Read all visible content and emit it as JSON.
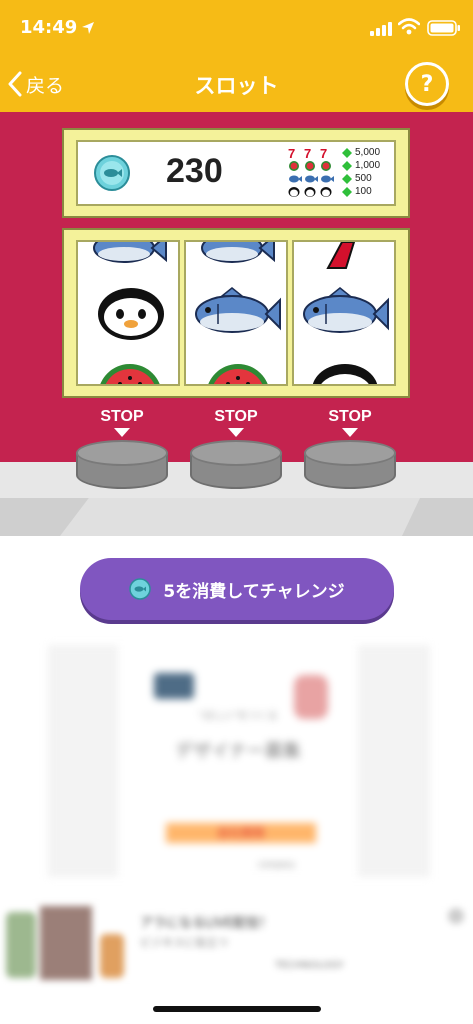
{
  "status_bar": {
    "time": "14:49"
  },
  "nav": {
    "back_label": "戻る",
    "title": "スロット",
    "help_label": "?"
  },
  "score": {
    "value": "230"
  },
  "paytable": [
    {
      "symbols": "777",
      "reward": "5,000"
    },
    {
      "symbols": "watermelon x3",
      "reward": "1,000"
    },
    {
      "symbols": "fish x3",
      "reward": "500"
    },
    {
      "symbols": "penguin x3",
      "reward": "100"
    }
  ],
  "reels": [
    {
      "top": "fish",
      "middle": "penguin",
      "bottom": "watermelon"
    },
    {
      "top": "fish",
      "middle": "fish",
      "bottom": "watermelon"
    },
    {
      "top": "seven",
      "middle": "fish",
      "bottom": "penguin"
    }
  ],
  "stop_buttons": {
    "label": "STOP"
  },
  "challenge": {
    "label": "5を消費してチャレンジ"
  },
  "ad": {
    "subtitle": "\"ほしい\"をつくる",
    "title": "デザイナー募集",
    "cta": "自社開発",
    "logo": "company"
  },
  "banner": {
    "text1": "アラになるLIVE配信！",
    "text2": "ビジネスに役立つ",
    "brand": "TECHNOLOGY"
  },
  "colors": {
    "header": "#f6bb16",
    "slot_bg": "#c4234f",
    "challenge": "#8056c0"
  }
}
